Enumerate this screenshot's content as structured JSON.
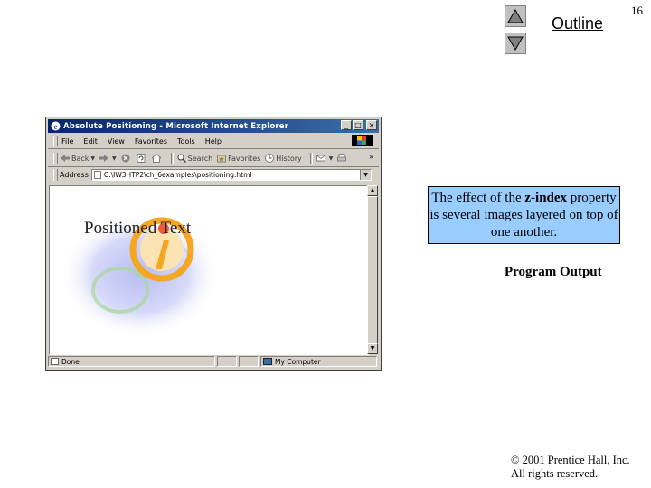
{
  "slide": {
    "outline_link": "Outline",
    "page_number": "16",
    "callout": {
      "before": "The effect of the ",
      "keyword": "z-index",
      "after": " property is several images layered on top of one another."
    },
    "program_output": "Program Output",
    "copyright_line1": "© 2001 Prentice Hall, Inc.",
    "copyright_line2": "All rights reserved.",
    "callout_bg": "#99ccff"
  },
  "browser": {
    "title": "Absolute Positioning - Microsoft Internet Explorer",
    "window_buttons": [
      "_",
      "□",
      "×"
    ],
    "menu": [
      "File",
      "Edit",
      "View",
      "Favorites",
      "Tools",
      "Help"
    ],
    "toolbar": {
      "back": "Back",
      "forward": "",
      "search": "Search",
      "favorites": "Favorites",
      "history": "History",
      "more": "»"
    },
    "address_label": "Address",
    "address_value": "C:\\IW3HTP2\\ch_6examples\\positioning.html",
    "page_text": "Positioned Text",
    "status_text": "Done",
    "status_zone": "My Computer",
    "title_gradient": [
      "#0a246a",
      "#3a6ea5"
    ]
  },
  "icons": {
    "up": "triangle-up-icon",
    "down": "triangle-down-icon",
    "ie": "ie-logo-icon"
  }
}
